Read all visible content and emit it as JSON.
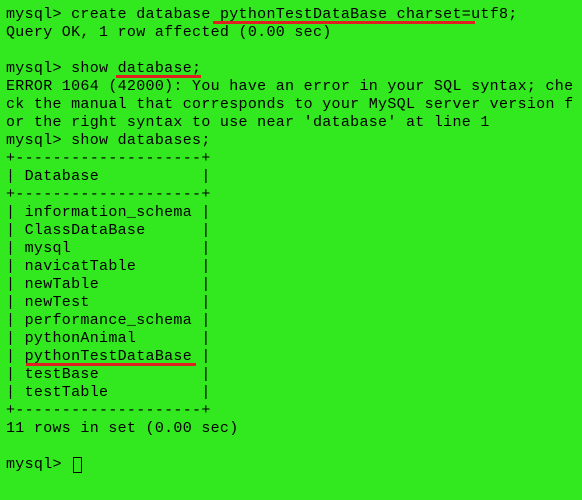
{
  "prompt": "mysql> ",
  "cmd1": "create database pythonTestDataBase charset=utf8;",
  "resp1": "Query OK, 1 row affected (0.00 sec)",
  "cmd2": "show database;",
  "err_line1": "ERROR 1064 (42000): You have an error in your SQL syntax; che",
  "err_line2": "ck the manual that corresponds to your MySQL server version f",
  "err_line3": "or the right syntax to use near 'database' at line 1",
  "cmd3": "show databases;",
  "table_border": "+--------------------+",
  "table_header": "| Database           |",
  "rows": [
    "| information_schema |",
    "| ClassDataBase      |",
    "| mysql              |",
    "| navicatTable       |",
    "| newTable           |",
    "| newTest            |",
    "| performance_schema |",
    "| pythonAnimal       |",
    "| pythonTestDataBase |",
    "| testBase           |",
    "| testTable          |"
  ],
  "result_summary": "11 rows in set (0.00 sec)"
}
